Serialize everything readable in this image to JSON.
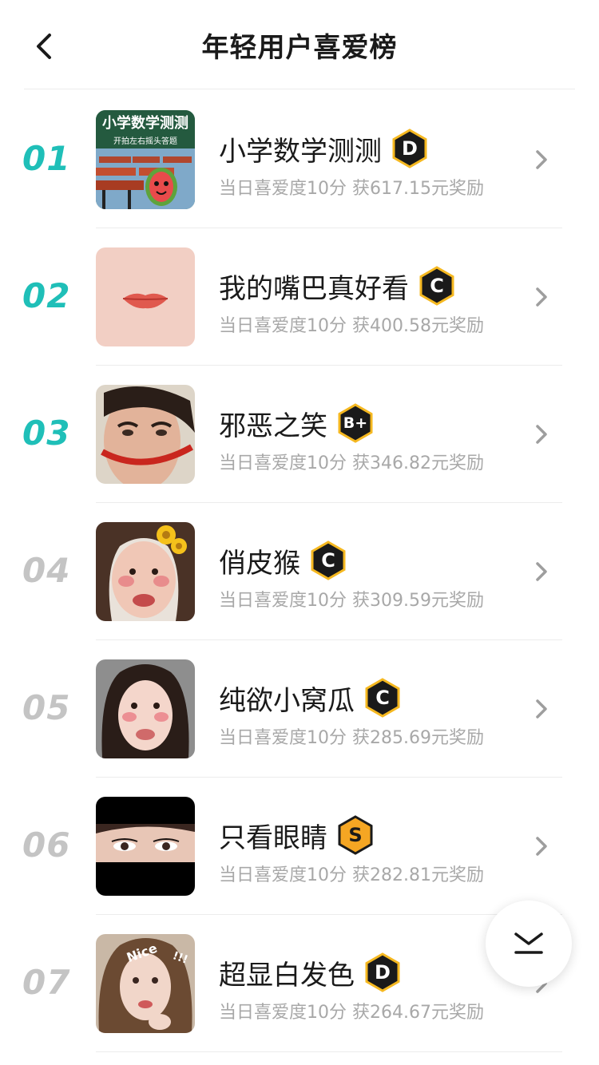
{
  "header": {
    "title": "年轻用户喜爱榜",
    "back_icon": "chevron-left-icon"
  },
  "colors": {
    "rank_top": "#1fbfb8",
    "rank_other": "#c4c4c4",
    "grade_fill": "#1a1a1a",
    "grade_border": "#f5b820",
    "grade_s_fill": "#f5a623"
  },
  "items": [
    {
      "rank": "01",
      "name": "小学数学测测",
      "grade": "D",
      "subtitle": "当日喜爱度10分 获617.15元奖励",
      "thumb_text_title": "小学数学测测",
      "thumb_text_sub": "开拍左右摇头答题"
    },
    {
      "rank": "02",
      "name": "我的嘴巴真好看",
      "grade": "C",
      "subtitle": "当日喜爱度10分 获400.58元奖励"
    },
    {
      "rank": "03",
      "name": "邪恶之笑",
      "grade": "B+",
      "subtitle": "当日喜爱度10分 获346.82元奖励"
    },
    {
      "rank": "04",
      "name": "俏皮猴",
      "grade": "C",
      "subtitle": "当日喜爱度10分 获309.59元奖励"
    },
    {
      "rank": "05",
      "name": "纯欲小窝瓜",
      "grade": "C",
      "subtitle": "当日喜爱度10分 获285.69元奖励"
    },
    {
      "rank": "06",
      "name": "只看眼睛",
      "grade": "S",
      "subtitle": "当日喜爱度10分 获282.81元奖励"
    },
    {
      "rank": "07",
      "name": "超显白发色",
      "grade": "D",
      "subtitle": "当日喜爱度10分 获264.67元奖励",
      "thumb_text_title": "Nice",
      "thumb_text_sub": "!!!"
    }
  ],
  "fab": {
    "icon": "collapse-down-icon"
  }
}
